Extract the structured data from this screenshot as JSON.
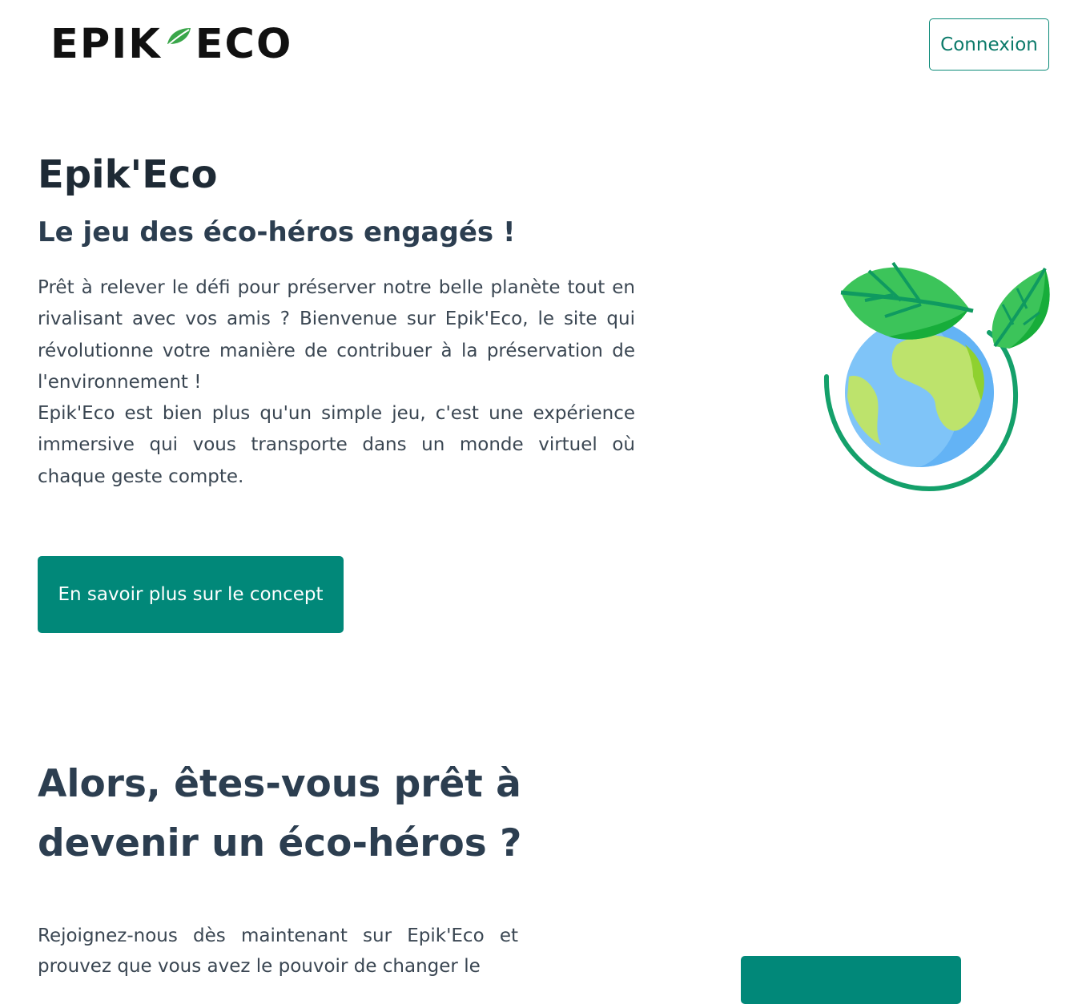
{
  "header": {
    "logo_text_left": "EPIK",
    "logo_text_right": "ECO",
    "login_label": "Connexion"
  },
  "hero": {
    "title": "Epik'Eco",
    "subtitle": "Le jeu des éco-héros engagés !",
    "paragraph1": "Prêt à relever le défi pour préserver notre belle planète tout en rivalisant avec vos amis ? Bienvenue sur Epik'Eco, le site qui révolutionne votre manière de contribuer à la préservation de l'environnement !",
    "paragraph2": "Epik'Eco est bien plus qu'un simple jeu, c'est une expérience immersive qui vous transporte dans un monde virtuel où chaque geste compte.",
    "cta_label": "En savoir plus sur le concept"
  },
  "section2": {
    "title": "Alors, êtes-vous prêt à devenir un éco-héros ?",
    "text": "Rejoignez-nous dès maintenant sur Epik'Eco et prouvez que vous avez le pouvoir de changer le"
  },
  "colors": {
    "accent": "#018879",
    "text_dark": "#2c3e50",
    "leaf_green": "#3cc45a"
  },
  "icons": {
    "logo_leaf": "leaf-icon",
    "hero_image": "globe-with-leaves-icon"
  }
}
